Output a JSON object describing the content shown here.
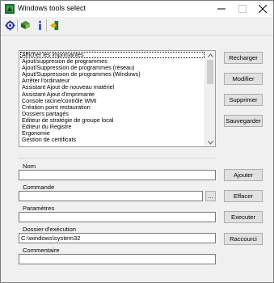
{
  "window": {
    "title": "Windows tools select"
  },
  "list": {
    "items": [
      "Afficher les imprimantes",
      "Ajout/suppresion de programmes",
      "Ajout/Suppression de programmes (réseau)",
      "Ajout/Suppression de programmes (Windows)",
      "Arrêter l'ordinateur",
      "Assistant Ajout de nouveau matériel",
      "Assistant Ajout d'imprimante",
      "Console racine/contrôle WMI",
      "Création point restauration",
      "Dossiers partagés",
      "Editeur de stratégie de groupe local",
      "Editeur du Registre",
      "Ergonomie",
      "Gestion de certificats"
    ]
  },
  "buttons": {
    "recharger": "Recharger",
    "modifier": "Modifier",
    "supprimer": "Supprimer",
    "sauvegarder": "Sauvegarder",
    "ajouter": "Ajouter",
    "effacer": "Effacer",
    "executer": "Executer",
    "raccourci": "Raccourci",
    "browse": "..."
  },
  "fields": {
    "nom": {
      "label": "Nom",
      "value": ""
    },
    "commande": {
      "label": "Commande",
      "value": ""
    },
    "parametres": {
      "label": "Paramètres",
      "value": ""
    },
    "dossier": {
      "label": "Dossier d'exécution",
      "value": "C:\\windows\\system32"
    },
    "commentaire": {
      "label": "Commentaire",
      "value": ""
    }
  },
  "toolbar": {
    "icons": [
      "gear-icon",
      "book-icon",
      "info-icon",
      "exit-icon"
    ]
  },
  "colors": {
    "window_bg": "#f0f0f0",
    "button_bg": "#e1e1e1"
  }
}
